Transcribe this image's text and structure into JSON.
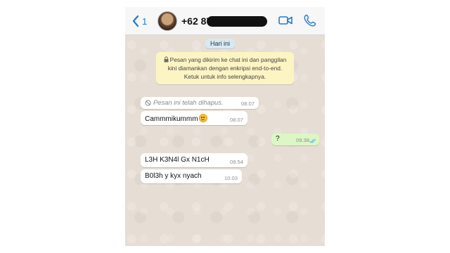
{
  "header": {
    "back_count": "1",
    "contact_name": "+62 87",
    "icons": {
      "back": "chevron-left-icon",
      "video": "video-call-icon",
      "call": "phone-icon"
    }
  },
  "chat": {
    "date_chip": "Hari ini",
    "notice": "Pesan yang dikirim ke chat ini dan panggilan kini diamankan dengan enkripsi end-to-end. Ketuk untuk info selengkapnya.",
    "messages": [
      {
        "direction": "incoming",
        "text": "Pesan ini telah dihapus.",
        "time": "08.07",
        "deleted": true
      },
      {
        "direction": "incoming",
        "text": "Cammmikummm",
        "time": "08.07",
        "emoji": "smiling-face"
      },
      {
        "direction": "outgoing",
        "text": "?",
        "time": "09.38",
        "status": "read"
      },
      {
        "direction": "incoming",
        "text": "L3H K3N4l Gx N1cH",
        "time": "09.54"
      },
      {
        "direction": "incoming",
        "text": "B0l3h y kyx nyach",
        "time": "10.03"
      }
    ]
  },
  "colors": {
    "accent": "#1e7bd8",
    "chat_background": "#e6ddd4",
    "outgoing_bubble": "#dcf7c5",
    "notice_background": "#fdf4c4",
    "date_chip_background": "#d6e9f5",
    "read_ticks": "#4fb3e8"
  }
}
